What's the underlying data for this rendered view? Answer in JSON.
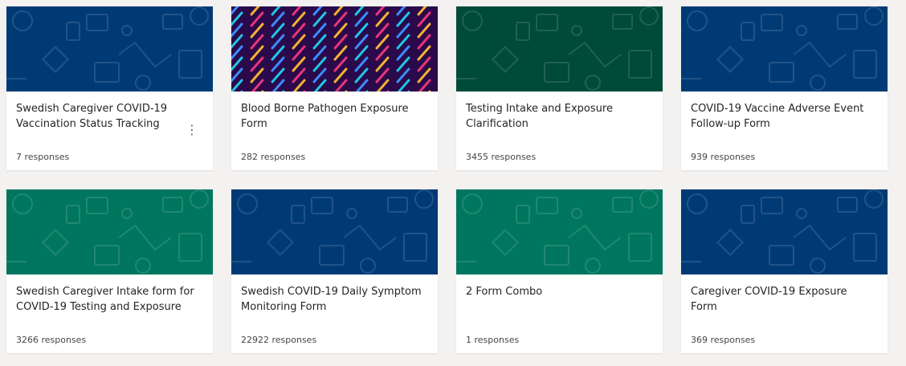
{
  "forms": [
    {
      "title": "Swedish Caregiver COVID-19 Vaccination Status Tracking",
      "responses": "7 responses",
      "banner_theme": "navy-icons",
      "banner_color": "#003a75",
      "has_more_menu": true
    },
    {
      "title": "Blood Borne Pathogen Exposure Form",
      "responses": "282 responses",
      "banner_theme": "diagonal-stripes",
      "banner_color": "#2a0a4a",
      "has_more_menu": false
    },
    {
      "title": "Testing Intake and Exposure Clarification",
      "responses": "3455 responses",
      "banner_theme": "darkgreen-icons",
      "banner_color": "#004a3a",
      "has_more_menu": false
    },
    {
      "title": "COVID-19 Vaccine Adverse Event Follow-up Form",
      "responses": "939 responses",
      "banner_theme": "navy-icons",
      "banner_color": "#003a75",
      "has_more_menu": false
    },
    {
      "title": "Swedish Caregiver Intake form for COVID-19 Testing and Exposure",
      "responses": "3266 responses",
      "banner_theme": "teal-icons",
      "banner_color": "#00765f",
      "has_more_menu": false
    },
    {
      "title": "Swedish COVID-19 Daily Symptom Monitoring Form",
      "responses": "22922 responses",
      "banner_theme": "navy-icons",
      "banner_color": "#003a75",
      "has_more_menu": false
    },
    {
      "title": "2 Form Combo",
      "responses": "1 responses",
      "banner_theme": "teal-icons",
      "banner_color": "#00765f",
      "has_more_menu": false
    },
    {
      "title": "Caregiver COVID-19 Exposure Form",
      "responses": "369 responses",
      "banner_theme": "navy-icons",
      "banner_color": "#003a75",
      "has_more_menu": false
    }
  ],
  "more_menu_glyph": "⋮",
  "stripe_colors": [
    "#f2b233",
    "#1fc7e6",
    "#e8357a",
    "#3c8dff"
  ]
}
